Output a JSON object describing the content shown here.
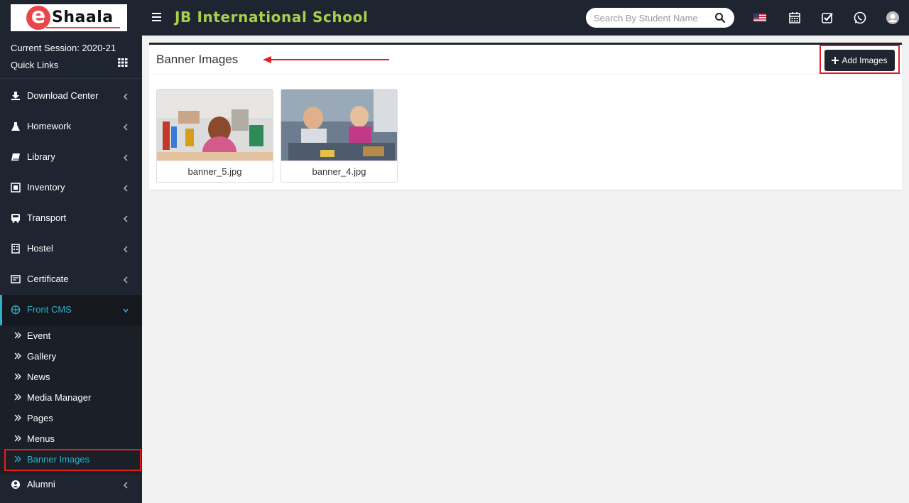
{
  "header": {
    "logo_text": "Shaala",
    "logo_letter": "e",
    "school_name": "JB International School",
    "search_placeholder": "Search By Student Name"
  },
  "sidebar": {
    "session": "Current Session: 2020-21",
    "quick_links": "Quick Links",
    "items": [
      {
        "label": "Download Center",
        "icon": "download-icon"
      },
      {
        "label": "Homework",
        "icon": "flask-icon"
      },
      {
        "label": "Library",
        "icon": "book-icon"
      },
      {
        "label": "Inventory",
        "icon": "inventory-icon"
      },
      {
        "label": "Transport",
        "icon": "bus-icon"
      },
      {
        "label": "Hostel",
        "icon": "building-icon"
      },
      {
        "label": "Certificate",
        "icon": "certificate-icon"
      },
      {
        "label": "Front CMS",
        "icon": "cms-icon"
      },
      {
        "label": "Alumni",
        "icon": "alumni-icon"
      }
    ],
    "sub_items": [
      {
        "label": "Event"
      },
      {
        "label": "Gallery"
      },
      {
        "label": "News"
      },
      {
        "label": "Media Manager"
      },
      {
        "label": "Pages"
      },
      {
        "label": "Menus"
      },
      {
        "label": "Banner Images"
      }
    ]
  },
  "main": {
    "title": "Banner Images",
    "add_button": "Add Images",
    "images": [
      {
        "filename": "banner_5.jpg"
      },
      {
        "filename": "banner_4.jpg"
      }
    ]
  },
  "colors": {
    "dark": "#1e2430",
    "accent": "#2bb0c6",
    "title_green": "#a8d14b",
    "highlight_red": "#e02020"
  }
}
